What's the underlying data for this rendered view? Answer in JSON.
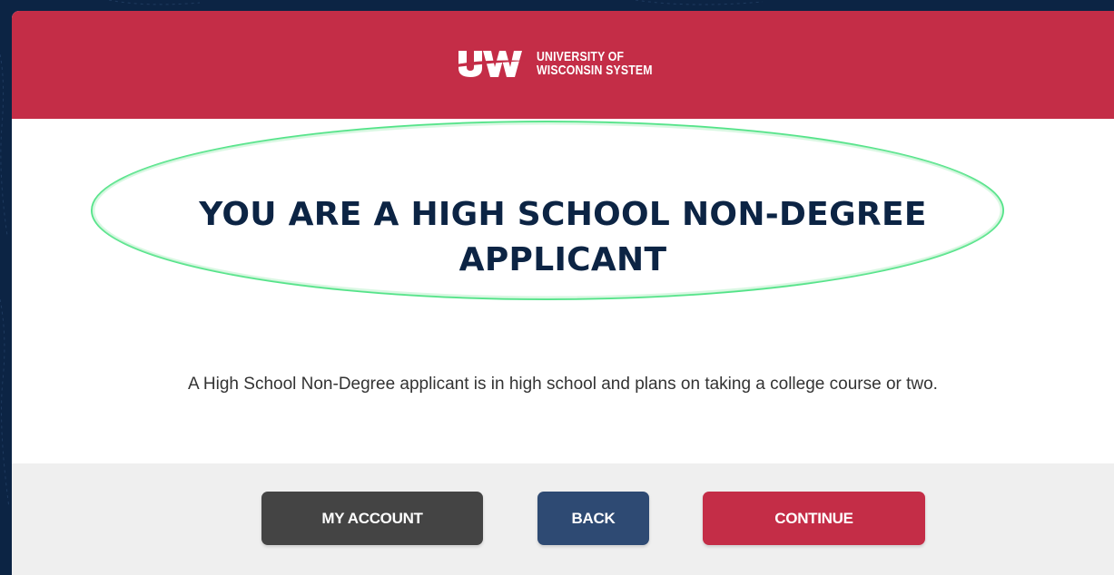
{
  "brand": {
    "logo_line1": "UNIVERSITY OF",
    "logo_line2": "WISCONSIN SYSTEM",
    "header_color": "#c42d47",
    "navy": "#0c2444"
  },
  "main": {
    "title_line1": "YOU ARE A HIGH SCHOOL NON-DEGREE",
    "title_line2": "APPLICANT",
    "description": "A High School Non-Degree applicant is in high school and plans on taking a college course or two."
  },
  "footer": {
    "my_account_label": "MY ACCOUNT",
    "back_label": "BACK",
    "continue_label": "CONTINUE"
  },
  "icons": {
    "logo": "uw-logo-icon"
  }
}
